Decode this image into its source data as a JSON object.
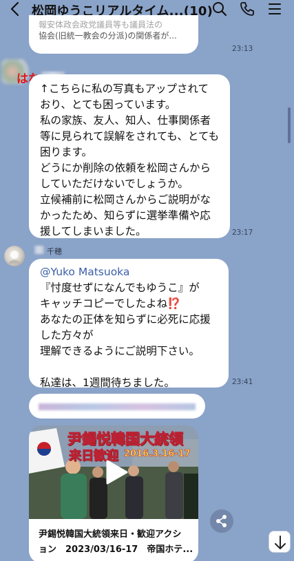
{
  "header": {
    "title": "松岡ゆうこリアルタイム...(10)",
    "icons": [
      "back-arrow-icon",
      "search-icon",
      "phone-icon",
      "menu-icon"
    ]
  },
  "messages": [
    {
      "id": "m0",
      "text_lines": [
        "報安体政会政党議員等も議員法の",
        "協会(旧統一教会の分派)の関係者が..."
      ],
      "time": "23:13"
    },
    {
      "id": "m1",
      "sender": "はな",
      "text_lines": [
        "↑こちらに私の写真もアップされて",
        "おり、とても困っています。",
        "私の家族、友人、知人、仕事関係者",
        "等に見られて誤解をされても、とても",
        "困ります。",
        "どうにか削除の依頼を松岡さんから",
        "していただけないでしょうか。",
        "立候補前に松岡さんからご説明がな",
        "かったため、知らずに選挙準備や応",
        "援してしまいました。"
      ],
      "time": "23:17"
    },
    {
      "id": "m2",
      "sender": "千穂",
      "mention": "@Yuko Matsuoka",
      "text_lines": [
        "『忖度せずになんでもゆうこ』が",
        "キャッチコピーでしたよね⁉️",
        "あなたの正体を知らずに必死に応援",
        "した方々が",
        "理解できるようにご説明下さい。",
        "",
        "私達は、1週間待ちました。"
      ],
      "time": "23:41"
    }
  ],
  "link_card": {
    "thumb_caption_line1": "尹錫悦韓国大統領",
    "thumb_caption_line2": "来日歓迎",
    "thumb_caption_date": "2016.3.16-17",
    "title_line1": "尹錫悦韓国大統領来日・歓迎アクシ",
    "title_line2": "ョン　2023/03/16-17　帝国ホテ..."
  },
  "colors": {
    "background": "#8aa3c8",
    "bubble": "#ffffff",
    "sender_name": "#e01818",
    "mention": "#3a5ea8"
  }
}
